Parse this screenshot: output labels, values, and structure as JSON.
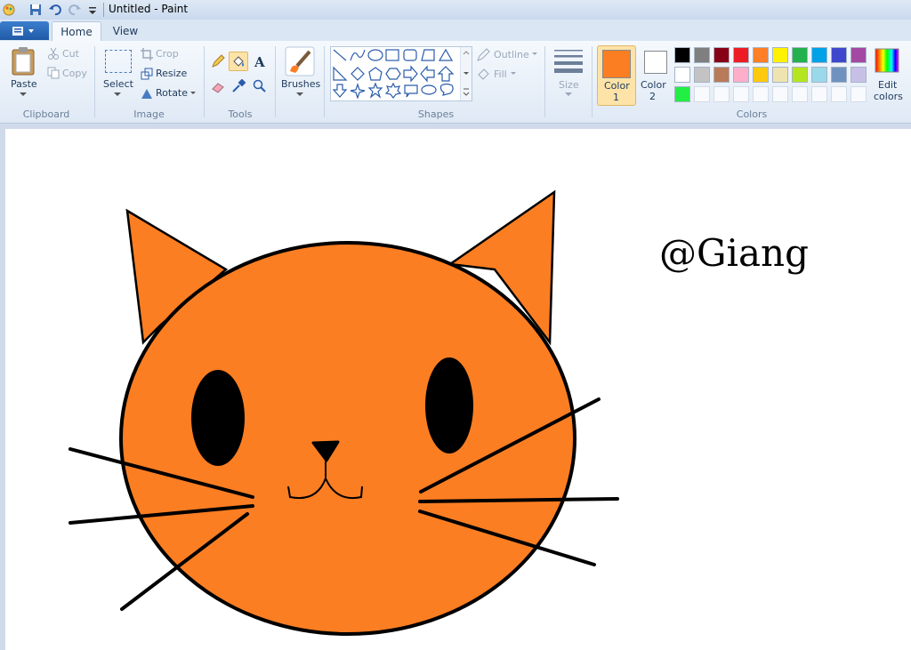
{
  "window": {
    "title": "Untitled - Paint"
  },
  "tabs": {
    "home": "Home",
    "view": "View"
  },
  "clipboard": {
    "paste": "Paste",
    "cut": "Cut",
    "copy": "Copy",
    "label": "Clipboard"
  },
  "image": {
    "select": "Select",
    "crop": "Crop",
    "resize": "Resize",
    "rotate": "Rotate",
    "label": "Image"
  },
  "tools": {
    "label": "Tools",
    "active_tool": "fill"
  },
  "brushes": {
    "label": "Brushes"
  },
  "shapes": {
    "label": "Shapes",
    "outline": "Outline",
    "fill": "Fill"
  },
  "size": {
    "label": "Size"
  },
  "colors": {
    "label": "Colors",
    "color1_label": "Color",
    "color1_num": "1",
    "color2_label": "Color",
    "color2_num": "2",
    "edit_label": "Edit",
    "edit_label2": "colors",
    "color1_value": "#fc7e22",
    "color2_value": "#ffffff",
    "palette_row1": [
      "#000000",
      "#7f7f7f",
      "#880015",
      "#ed1c24",
      "#ff7f27",
      "#fff200",
      "#22b14c",
      "#00a2e8",
      "#3f48cc",
      "#a349a4"
    ],
    "palette_row2": [
      "#ffffff",
      "#c3c3c3",
      "#b97a57",
      "#ffaec9",
      "#ffc90e",
      "#efe4b0",
      "#b5e61d",
      "#99d9ea",
      "#7092be",
      "#c8bfe7"
    ],
    "palette_row3": [
      "#22ee44",
      "",
      "",
      "",
      "",
      "",
      "",
      "",
      "",
      ""
    ]
  },
  "canvas": {
    "text": "@Giang",
    "cat_color": "#fc7e22"
  }
}
